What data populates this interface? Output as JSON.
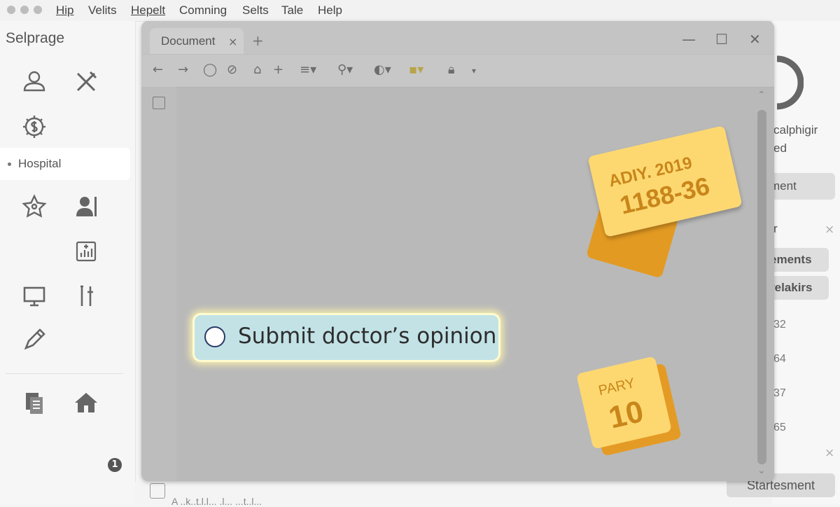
{
  "menubar": {
    "items": [
      "Hip",
      "Velits",
      "Hepelt",
      "Comning",
      "Selts",
      "Tale",
      "Help"
    ]
  },
  "sidebar": {
    "title": "Selprage",
    "active_item": "Hospital",
    "badge": "1"
  },
  "document": {
    "tab_label": "Document",
    "tab_close": "×",
    "new_tab": "+",
    "submit_label": "Submit doctor’s opinion"
  },
  "notes": {
    "note1_line1": "ADIY. 2019",
    "note1_line2": "1188-36",
    "note2_line1": "PARY",
    "note2_line2": "10"
  },
  "right_panel": {
    "text1": "calphigir",
    "text2": "ed",
    "button1": "ment",
    "header": "r",
    "button2": "ements",
    "button3": "relakirs",
    "numbers": [
      "32",
      "64",
      "37",
      "65"
    ],
    "bottom_button": "Startesment"
  },
  "bottom_strip": {
    "text": "A ..k..t.l.l... .l... ...t..l..."
  },
  "colors": {
    "note_yellow": "#fdd871",
    "note_orange": "#e39a22",
    "pill_fill": "#c2e2e6",
    "pill_glow": "#fffbd0"
  }
}
